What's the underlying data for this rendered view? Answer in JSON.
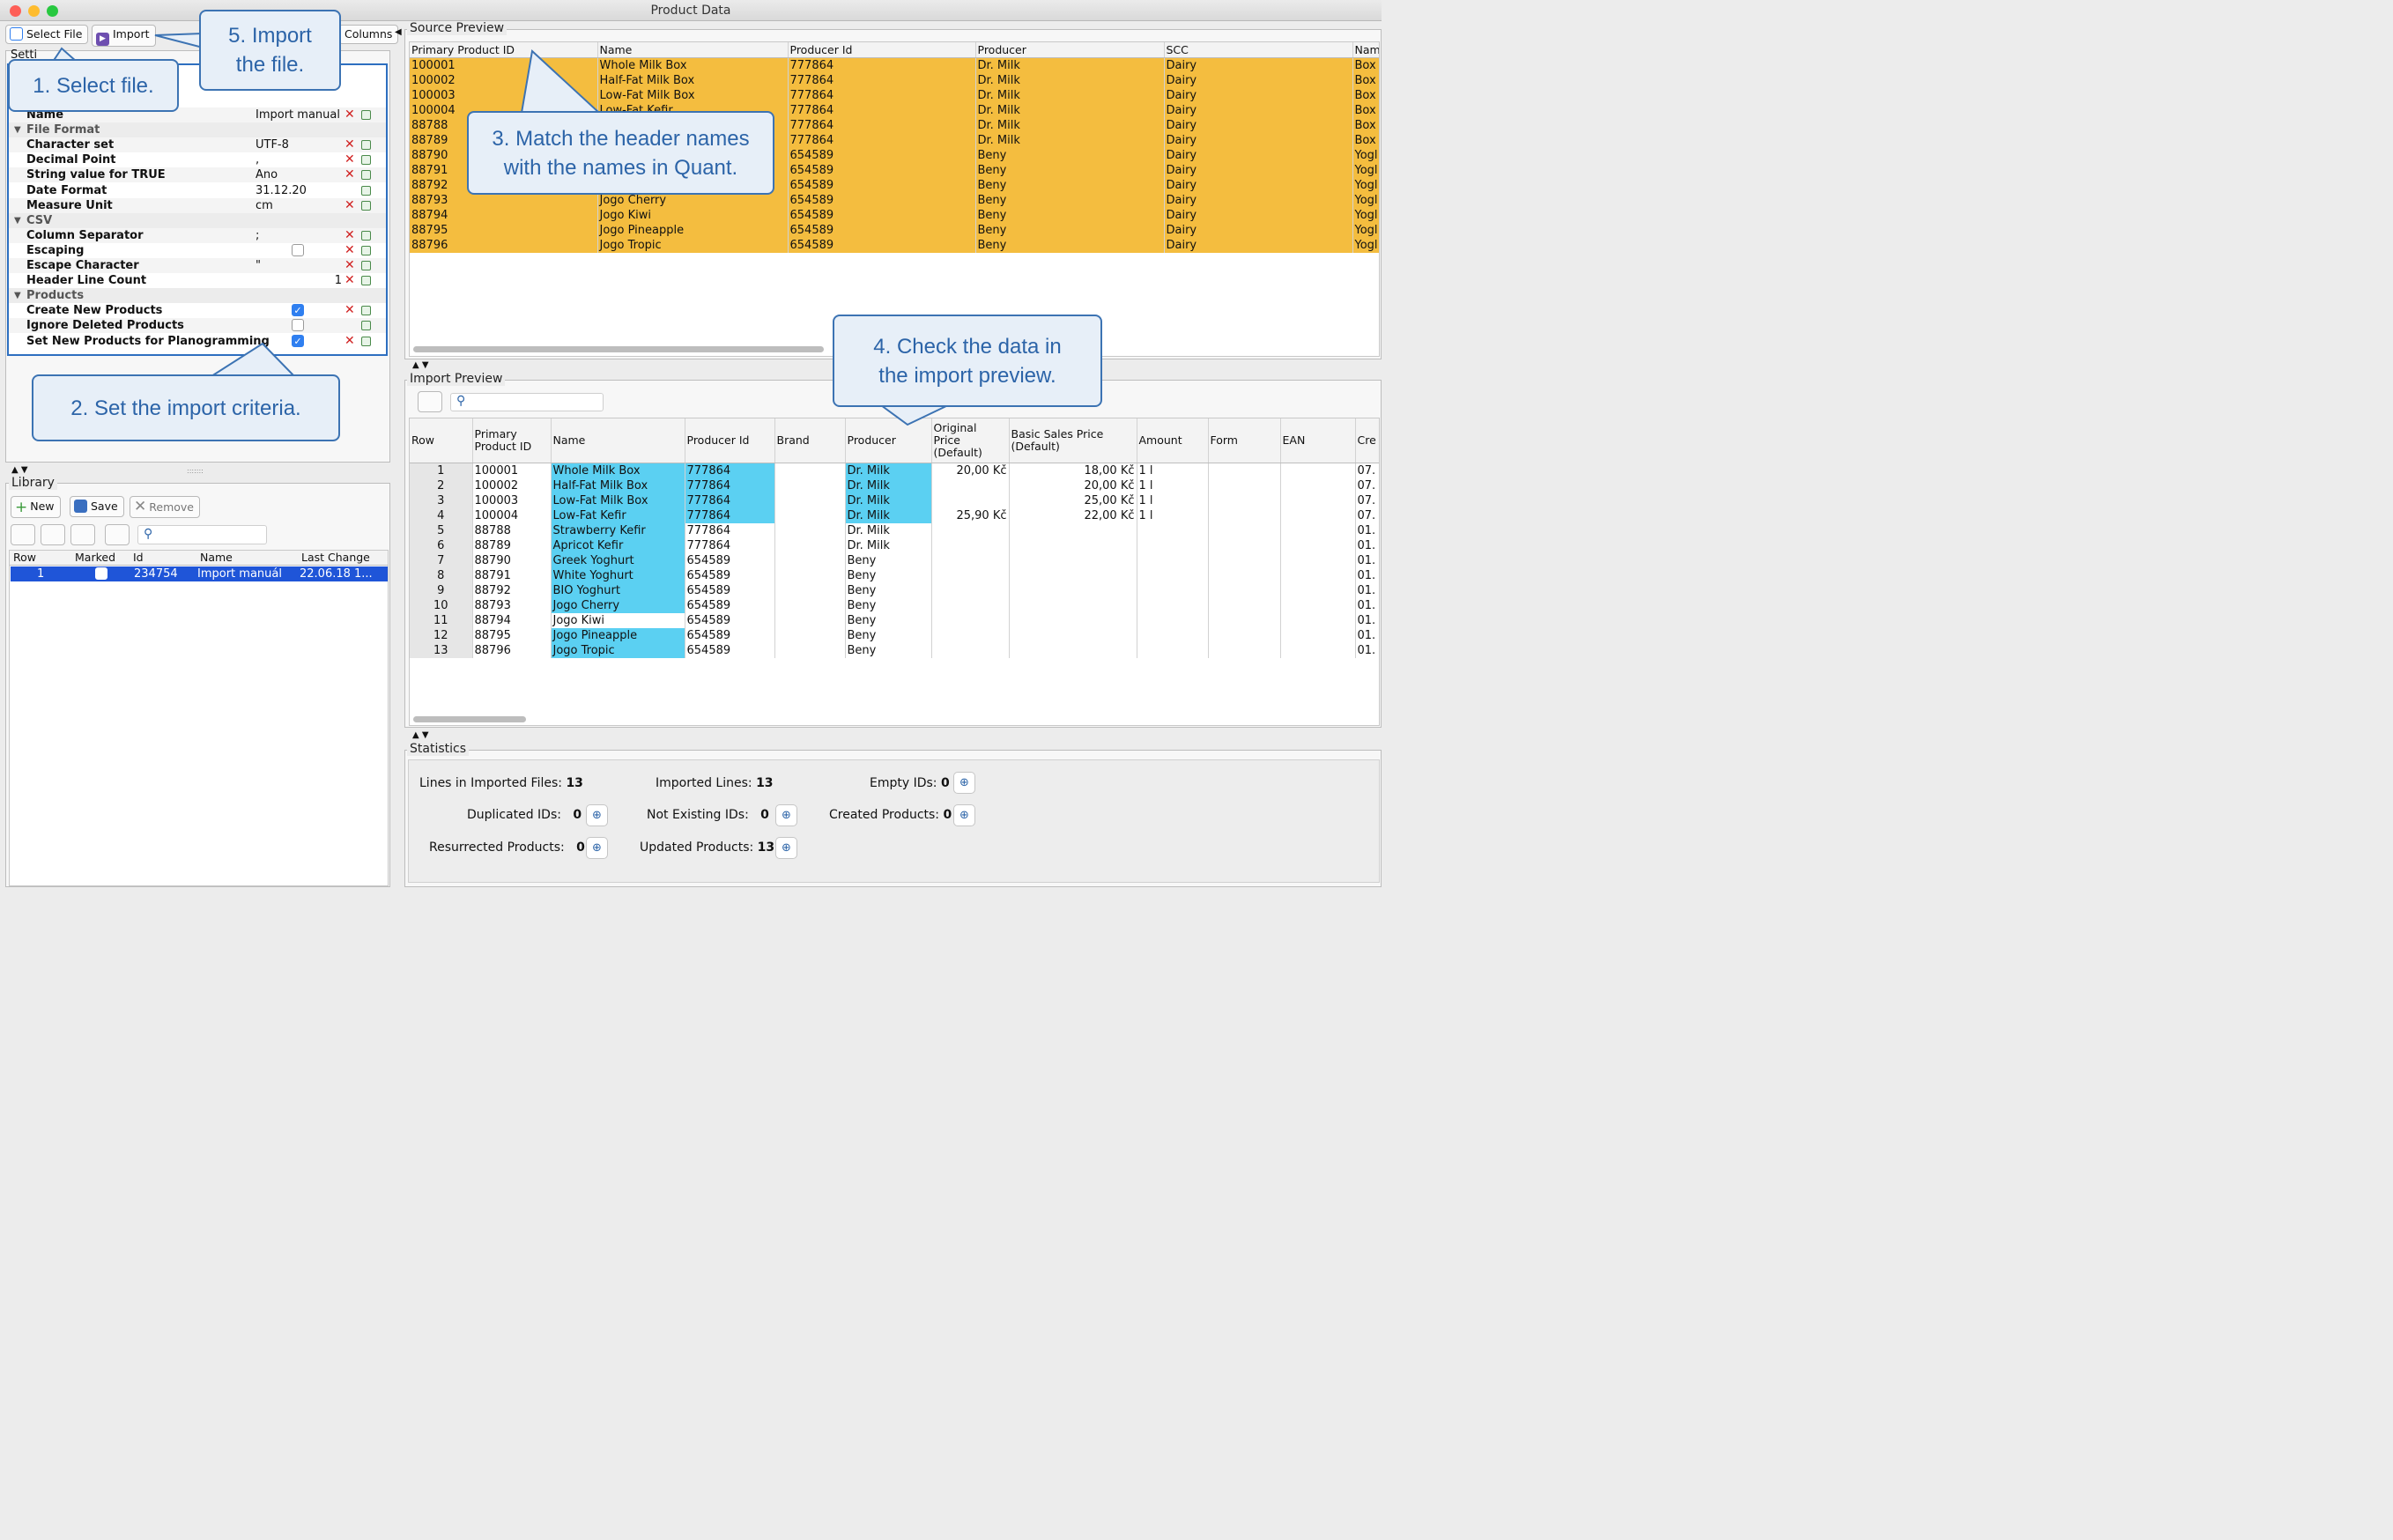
{
  "window": {
    "title": "Product Data"
  },
  "toolbar": {
    "select_file": "Select File",
    "import": "Import",
    "columns": "Columns"
  },
  "settings": {
    "title": "Setti",
    "rows": [
      {
        "type": "item",
        "label": "Name",
        "value": "Import manual",
        "x": true,
        "copy": true
      },
      {
        "type": "group",
        "label": "File Format"
      },
      {
        "type": "item",
        "label": "Character set",
        "value": "UTF-8",
        "x": true,
        "copy": true
      },
      {
        "type": "item",
        "label": "Decimal Point",
        "value": ",",
        "x": true,
        "copy": true
      },
      {
        "type": "item",
        "label": "String value for TRUE",
        "value": "Ano",
        "x": true,
        "copy": true
      },
      {
        "type": "item",
        "label": "Date Format",
        "value": "31.12.20",
        "x": false,
        "copy": true
      },
      {
        "type": "item",
        "label": "Measure Unit",
        "value": "cm",
        "x": true,
        "copy": true
      },
      {
        "type": "group",
        "label": "CSV"
      },
      {
        "type": "item",
        "label": "Column Separator",
        "value": ";",
        "x": true,
        "copy": true
      },
      {
        "type": "item",
        "label": "Escaping",
        "value": "",
        "check": "off",
        "x": true,
        "copy": true
      },
      {
        "type": "item",
        "label": "Escape Character",
        "value": "\"",
        "x": true,
        "copy": true
      },
      {
        "type": "item",
        "label": "Header Line Count",
        "value": "1",
        "right": true,
        "x": true,
        "copy": true
      },
      {
        "type": "group",
        "label": "Products"
      },
      {
        "type": "item",
        "label": "Create New Products",
        "value": "",
        "check": "on",
        "x": true,
        "copy": true
      },
      {
        "type": "item",
        "label": "Ignore Deleted Products",
        "value": "",
        "check": "off",
        "x": false,
        "copy": true
      },
      {
        "type": "item",
        "label": "Set New Products for Planogramming",
        "value": "",
        "check": "on",
        "x": true,
        "copy": true
      }
    ]
  },
  "library": {
    "title": "Library",
    "new": "New",
    "save": "Save",
    "remove": "Remove",
    "columns": [
      "Row",
      "Marked",
      "Id",
      "Name",
      "Last Change"
    ],
    "rows": [
      {
        "row": "1",
        "id": "234754",
        "name": "Import manuál",
        "last_change": "22.06.18 1..."
      }
    ]
  },
  "source_preview": {
    "title": "Source Preview",
    "columns": [
      "Primary Product ID",
      "Name",
      "Producer Id",
      "Producer",
      "SCC",
      "Nam"
    ],
    "rows": [
      [
        "100001",
        "Whole Milk Box",
        "777864",
        "Dr. Milk",
        "Dairy",
        "Box"
      ],
      [
        "100002",
        "Half-Fat Milk Box",
        "777864",
        "Dr. Milk",
        "Dairy",
        "Box"
      ],
      [
        "100003",
        "Low-Fat Milk Box",
        "777864",
        "Dr. Milk",
        "Dairy",
        "Box"
      ],
      [
        "100004",
        "Low-Fat Kefir",
        "777864",
        "Dr. Milk",
        "Dairy",
        "Box"
      ],
      [
        "88788",
        "",
        "777864",
        "Dr. Milk",
        "Dairy",
        "Box"
      ],
      [
        "88789",
        "",
        "777864",
        "Dr. Milk",
        "Dairy",
        "Box"
      ],
      [
        "88790",
        "",
        "654589",
        "Beny",
        "Dairy",
        "Yogl"
      ],
      [
        "88791",
        "",
        "654589",
        "Beny",
        "Dairy",
        "Yogl"
      ],
      [
        "88792",
        "",
        "654589",
        "Beny",
        "Dairy",
        "Yogl"
      ],
      [
        "88793",
        "Jogo Cherry",
        "654589",
        "Beny",
        "Dairy",
        "Yogl"
      ],
      [
        "88794",
        "Jogo Kiwi",
        "654589",
        "Beny",
        "Dairy",
        "Yogl"
      ],
      [
        "88795",
        "Jogo Pineapple",
        "654589",
        "Beny",
        "Dairy",
        "Yogl"
      ],
      [
        "88796",
        "Jogo Tropic",
        "654589",
        "Beny",
        "Dairy",
        "Yogl"
      ]
    ]
  },
  "import_preview": {
    "title": "Import Preview",
    "columns": [
      "Row",
      "Primary\nProduct ID",
      "Name",
      "Producer Id",
      "Brand",
      "Producer",
      "Original Price\n(Default)",
      "Basic Sales Price\n(Default)",
      "Amount",
      "Form",
      "EAN",
      "Cre"
    ],
    "rows": [
      [
        "1",
        "100001",
        "Whole Milk Box",
        "777864",
        "",
        "Dr. Milk",
        "20,00 Kč",
        "18,00 Kč",
        "1 l",
        "",
        "",
        "07."
      ],
      [
        "2",
        "100002",
        "Half-Fat Milk Box",
        "777864",
        "",
        "Dr. Milk",
        "",
        "20,00 Kč",
        "1 l",
        "",
        "",
        "07."
      ],
      [
        "3",
        "100003",
        "Low-Fat Milk Box",
        "777864",
        "",
        "Dr. Milk",
        "",
        "25,00 Kč",
        "1 l",
        "",
        "",
        "07."
      ],
      [
        "4",
        "100004",
        "Low-Fat Kefir",
        "777864",
        "",
        "Dr. Milk",
        "25,90 Kč",
        "22,00 Kč",
        "1 l",
        "",
        "",
        "07."
      ],
      [
        "5",
        "88788",
        "Strawberry Kefir",
        "777864",
        "",
        "Dr. Milk",
        "",
        "",
        "",
        "",
        "",
        "01."
      ],
      [
        "6",
        "88789",
        "Apricot Kefir",
        "777864",
        "",
        "Dr. Milk",
        "",
        "",
        "",
        "",
        "",
        "01."
      ],
      [
        "7",
        "88790",
        "Greek Yoghurt",
        "654589",
        "",
        "Beny",
        "",
        "",
        "",
        "",
        "",
        "01."
      ],
      [
        "8",
        "88791",
        "White Yoghurt",
        "654589",
        "",
        "Beny",
        "",
        "",
        "",
        "",
        "",
        "01."
      ],
      [
        "9",
        "88792",
        "BIO Yoghurt",
        "654589",
        "",
        "Beny",
        "",
        "",
        "",
        "",
        "",
        "01."
      ],
      [
        "10",
        "88793",
        "Jogo Cherry",
        "654589",
        "",
        "Beny",
        "",
        "",
        "",
        "",
        "",
        "01."
      ],
      [
        "11",
        "88794",
        "Jogo Kiwi",
        "654589",
        "",
        "Beny",
        "",
        "",
        "",
        "",
        "",
        "01."
      ],
      [
        "12",
        "88795",
        "Jogo Pineapple",
        "654589",
        "",
        "Beny",
        "",
        "",
        "",
        "",
        "",
        "01."
      ],
      [
        "13",
        "88796",
        "Jogo Tropic",
        "654589",
        "",
        "Beny",
        "",
        "",
        "",
        "",
        "",
        "01."
      ]
    ]
  },
  "statistics": {
    "title": "Statistics",
    "lines_label": "Lines in Imported Files:",
    "lines": "13",
    "imported_label": "Imported Lines:",
    "imported": "13",
    "empty_label": "Empty IDs:",
    "empty": "0",
    "dup_label": "Duplicated IDs:",
    "dup": "0",
    "notexist_label": "Not Existing IDs:",
    "notexist": "0",
    "created_label": "Created Products:",
    "created": "0",
    "resurrected_label": "Resurrected Products:",
    "resurrected": "0",
    "updated_label": "Updated Products:",
    "updated": "13"
  },
  "callouts": {
    "c1": "1. Select file.",
    "c2": "2. Set the import criteria.",
    "c3": "3. Match the header names with the names in Quant.",
    "c4": "4. Check the data in the import preview.",
    "c5": "5. Import the file."
  },
  "colors": {
    "source_row": "#f4bd3f",
    "import_highlight": "#5bd0f2",
    "selection": "#1f55d8",
    "callout_border": "#3c73b3",
    "callout_text": "#2c64a8"
  }
}
